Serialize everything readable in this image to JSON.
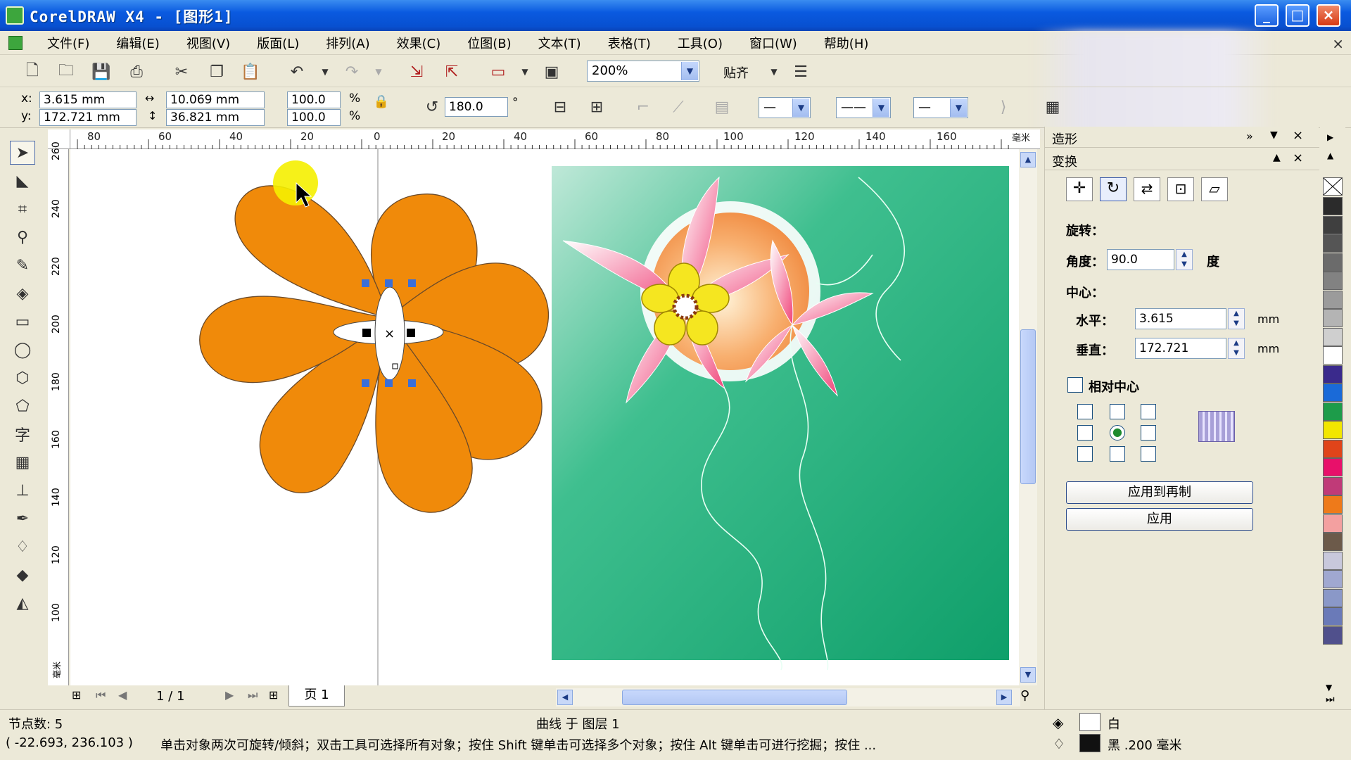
{
  "window": {
    "title": "CorelDRAW X4 - [图形1]",
    "min": "_",
    "max": "□",
    "close": "×"
  },
  "menu": {
    "items": [
      "文件(F)",
      "编辑(E)",
      "视图(V)",
      "版面(L)",
      "排列(A)",
      "效果(C)",
      "位图(B)",
      "文本(T)",
      "表格(T)",
      "工具(O)",
      "窗口(W)",
      "帮助(H)"
    ],
    "close": "×"
  },
  "toolbar": {
    "zoom": "200%",
    "snap": "贴齐"
  },
  "propbar": {
    "x_label": "x:",
    "x": "3.615 mm",
    "y_label": "y:",
    "y": "172.721 mm",
    "w": "10.069 mm",
    "h": "36.821 mm",
    "sx": "100.0",
    "sy": "100.0",
    "pct": "%",
    "angle": "180.0",
    "deg": "°"
  },
  "rulers": {
    "h_ticks": [
      "80",
      "60",
      "40",
      "20",
      "0",
      "20",
      "40",
      "60",
      "80",
      "100",
      "120",
      "140",
      "160"
    ],
    "h_unit": "毫米",
    "v_ticks": [
      "260",
      "240",
      "220",
      "200",
      "180",
      "160",
      "140",
      "120",
      "100"
    ],
    "v_unit": "毫米"
  },
  "pagebar": {
    "page_count": "1 / 1",
    "page_tab": "页 1"
  },
  "docker": {
    "header1": "造形",
    "header2": "变换",
    "rotate_label": "旋转：",
    "angle_label": "角度：",
    "angle_value": "90.0",
    "angle_unit": "度",
    "center_label": "中心：",
    "horizontal_label": "水平：",
    "horizontal_value": "3.615",
    "vertical_label": "垂直：",
    "vertical_value": "172.721",
    "unit": "mm",
    "relative_center": "相对中心",
    "apply_copy": "应用到再制",
    "apply": "应用"
  },
  "palette": {
    "colors": [
      "#2b2b2b",
      "#3f3f3f",
      "#555555",
      "#6b6b6b",
      "#828282",
      "#9b9b9b",
      "#b4b4b4",
      "#cfcfcf",
      "#ffffff",
      "#3a2a8c",
      "#1a6ad8",
      "#1d9c4a",
      "#f2e600",
      "#e0441a",
      "#e8106a",
      "#c03a78",
      "#ee7a1a",
      "#f3a0a0",
      "#6c5a4a",
      "#c8c8dc",
      "#a0a8d0",
      "#8a98c8",
      "#6a7ab8",
      "#50508c"
    ]
  },
  "status": {
    "nodes": "节点数: 5",
    "layer": "曲线 于 图层 1",
    "coords": "( -22.693, 236.103 )",
    "hint": "单击对象两次可旋转/倾斜；双击工具可选择所有对象；按住 Shift 键单击可选择多个对象；按住 Alt 键单击可进行挖掘；按住 ...",
    "fill_label": "白",
    "outline_label": "黑 .200 毫米"
  }
}
